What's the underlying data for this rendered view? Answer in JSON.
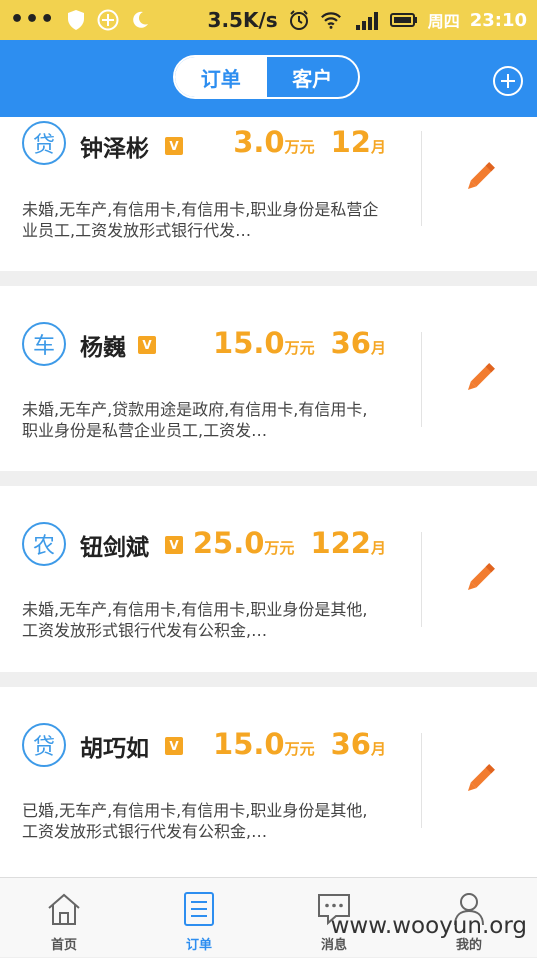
{
  "status_bar": {
    "net_speed": "3.5K/s",
    "weekday": "周四",
    "time": "23:10"
  },
  "header": {
    "tabs": [
      {
        "label": "订单",
        "active": true
      },
      {
        "label": "客户",
        "active": false
      }
    ]
  },
  "cards": [
    {
      "badge": "贷",
      "name": "钟泽彬",
      "amount": "3.0",
      "amount_unit": "万元",
      "term": "12",
      "term_unit": "月",
      "desc": "未婚,无车产,有信用卡,有信用卡,职业身份是私营企业员工,工资发放形式银行代发…"
    },
    {
      "badge": "车",
      "name": "杨巍",
      "amount": "15.0",
      "amount_unit": "万元",
      "term": "36",
      "term_unit": "月",
      "desc": "未婚,无车产,贷款用途是政府,有信用卡,有信用卡,职业身份是私营企业员工,工资发…"
    },
    {
      "badge": "农",
      "name": "钮剑斌",
      "amount": "25.0",
      "amount_unit": "万元",
      "term": "122",
      "term_unit": "月",
      "desc": "未婚,无车产,有信用卡,有信用卡,职业身份是其他,工资发放形式银行代发有公积金,…"
    },
    {
      "badge": "贷",
      "name": "胡巧如",
      "amount": "15.0",
      "amount_unit": "万元",
      "term": "36",
      "term_unit": "月",
      "desc": "已婚,无车产,有信用卡,有信用卡,职业身份是其他,工资发放形式银行代发有公积金,…"
    }
  ],
  "vip_badge": "V",
  "tabbar": [
    {
      "label": "首页",
      "icon": "home-icon"
    },
    {
      "label": "订单",
      "icon": "order-icon",
      "active": true
    },
    {
      "label": "消息",
      "icon": "message-icon"
    },
    {
      "label": "我的",
      "icon": "profile-icon"
    }
  ],
  "watermark": "www.wooyun.org",
  "colors": {
    "status_bar": "#f2d24f",
    "header": "#2d8ef0",
    "accent_orange": "#f5a623",
    "badge_blue": "#3d9ae8"
  }
}
